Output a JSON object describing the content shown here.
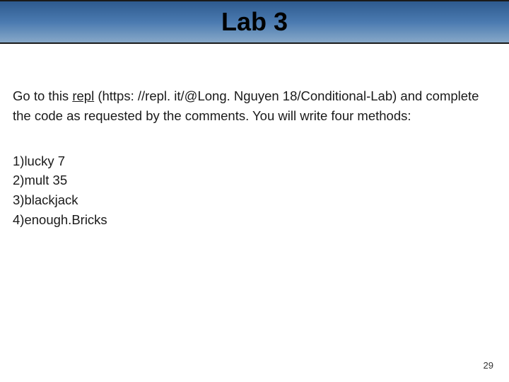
{
  "title": "Lab 3",
  "paragraph": {
    "prefix": "Go to this ",
    "link_text": "repl",
    "url_text": " (https: //repl. it/@Long. Nguyen 18/Conditional-Lab) and complete the code as requested by the comments. You will write four methods:"
  },
  "methods": [
    "1)lucky 7",
    "2)mult 35",
    "3)blackjack",
    "4)enough.Bricks"
  ],
  "page_number": "29"
}
